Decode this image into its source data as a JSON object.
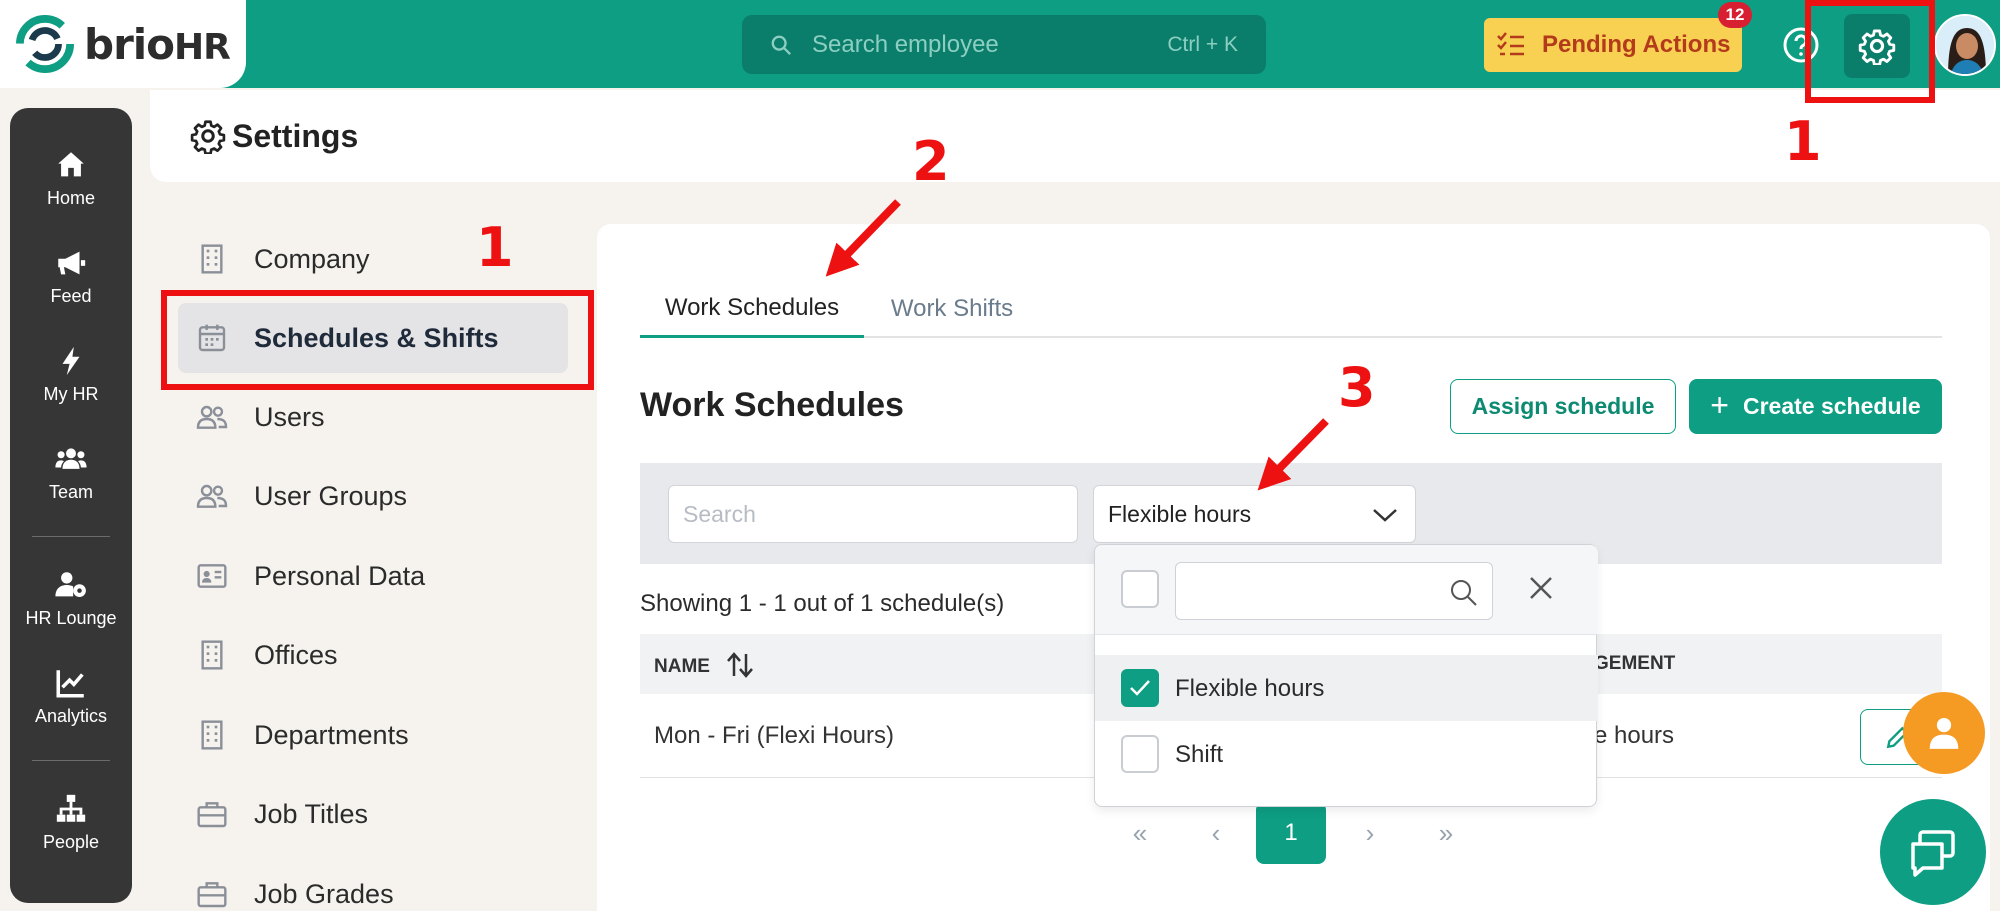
{
  "brand": {
    "logo_main": "brio",
    "logo_hr": "HR"
  },
  "topbar": {
    "search_placeholder": "Search employee",
    "search_shortcut": "Ctrl + K",
    "pending_label": "Pending Actions",
    "pending_count": "12"
  },
  "leftnav": [
    {
      "label": "Home",
      "icon": "home-icon"
    },
    {
      "label": "Feed",
      "icon": "megaphone-icon"
    },
    {
      "label": "My HR",
      "icon": "bolt-icon"
    },
    {
      "label": "Team",
      "icon": "team-icon"
    },
    {
      "label": "HR Lounge",
      "icon": "user-gear-icon"
    },
    {
      "label": "Analytics",
      "icon": "chart-icon"
    },
    {
      "label": "People",
      "icon": "org-chart-icon"
    }
  ],
  "page": {
    "title": "Settings"
  },
  "settings_menu": [
    {
      "label": "Company",
      "icon": "building-icon"
    },
    {
      "label": "Schedules & Shifts",
      "icon": "calendar-icon"
    },
    {
      "label": "Users",
      "icon": "users-icon"
    },
    {
      "label": "User Groups",
      "icon": "users-icon"
    },
    {
      "label": "Personal Data",
      "icon": "id-card-icon"
    },
    {
      "label": "Offices",
      "icon": "building-icon"
    },
    {
      "label": "Departments",
      "icon": "building-icon"
    },
    {
      "label": "Job Titles",
      "icon": "briefcase-icon"
    },
    {
      "label": "Job Grades",
      "icon": "briefcase-icon"
    }
  ],
  "tabs": [
    {
      "label": "Work Schedules"
    },
    {
      "label": "Work Shifts"
    }
  ],
  "main": {
    "section_title": "Work Schedules",
    "assign_label": "Assign schedule",
    "create_label": "Create schedule",
    "filter_search_placeholder": "Search",
    "filter_type_value": "Flexible hours",
    "showing_text": "Showing 1 - 1 out of 1 schedule(s)"
  },
  "table": {
    "columns": [
      "NAME",
      "GEMENT"
    ],
    "rows": [
      {
        "name": "Mon - Fri (Flexi Hours)",
        "management": "e hours"
      }
    ]
  },
  "pagination": {
    "current": "1"
  },
  "dropdown": {
    "options": [
      {
        "label": "Flexible hours",
        "checked": true
      },
      {
        "label": "Shift",
        "checked": false
      }
    ]
  },
  "annotations": {
    "n1": "1",
    "n2": "2",
    "n3": "3"
  },
  "colors": {
    "primary": "#0d9e83",
    "annotation": "#ee1111",
    "pending_bg": "#f8d153",
    "sidebar": "#363636"
  }
}
